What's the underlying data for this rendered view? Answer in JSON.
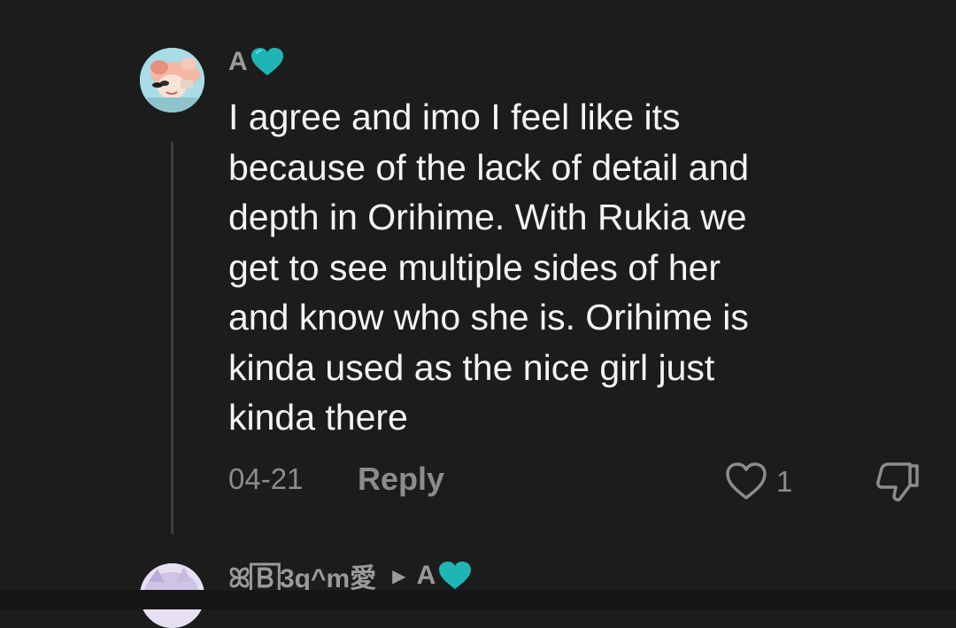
{
  "comment": {
    "username": "A",
    "username_emoji": "teal-heart",
    "text": "I agree and imo I feel like its\nbecause of the lack of detail and\ndepth in Orihime. With Rukia we\nget to see multiple sides of her\nand know who she is. Orihime is\nkinda used as the nice girl just\nkinda there",
    "date": "04-21",
    "reply_label": "Reply",
    "like_count": "1",
    "like_icon": "heart-outline-icon",
    "dislike_icon": "thumbs-down-icon"
  },
  "reply": {
    "username": "ꕤ🄱3q^m愛",
    "reply_to": "A",
    "reply_to_emoji": "teal-heart"
  },
  "colors": {
    "background": "#1c1c1c",
    "text": "#f4f4f4",
    "muted": "#8c8c8c",
    "accent_heart": "#1fb5b5"
  }
}
